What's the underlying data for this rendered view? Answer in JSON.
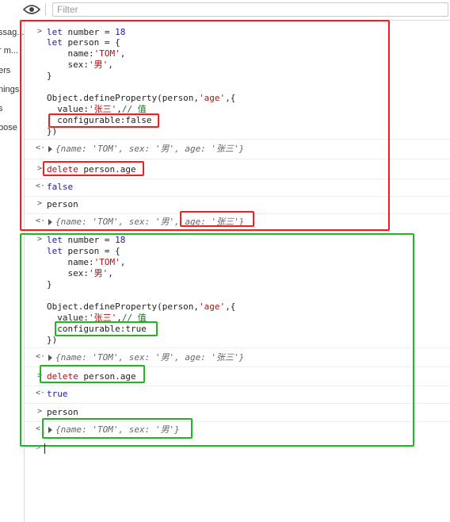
{
  "toolbar": {
    "filter_placeholder": "Filter",
    "eye_icon": "eye-icon"
  },
  "sidebar": {
    "items": [
      "ssag...",
      "r m...",
      "ers",
      "nings",
      "s",
      "bose"
    ]
  },
  "block1": {
    "code": [
      "let number = 18",
      "let person = {",
      "    name:'TOM',",
      "    sex:'男',",
      "}",
      "",
      "Object.defineProperty(person,'age',{",
      "  value:'张三',// 值",
      "  configurable:false",
      "})"
    ],
    "result1": "{name: 'TOM', sex: '男', age: '张三'}",
    "cmd_delete": "delete person.age",
    "delete_result": "false",
    "cmd_person": "person",
    "result2_pre": "{name: 'TOM', sex: '男', ",
    "result2_age": "age: '张三'}"
  },
  "block2": {
    "code": [
      "let number = 18",
      "let person = {",
      "    name:'TOM',",
      "    sex:'男',",
      "}",
      "",
      "Object.defineProperty(person,'age',{",
      "  value:'张三',// 值",
      "  configurable:true",
      "})"
    ],
    "result1": "{name: 'TOM', sex: '男', age: '张三'}",
    "cmd_delete": "delete person.age",
    "delete_result": "true",
    "cmd_person": "person",
    "result2": "{name: 'TOM', sex: '男'}"
  },
  "colors": {
    "red_box": "#ff1a1a",
    "green_box": "#1fb61f",
    "keyword": "#1a1aa6",
    "string": "#a31515"
  }
}
